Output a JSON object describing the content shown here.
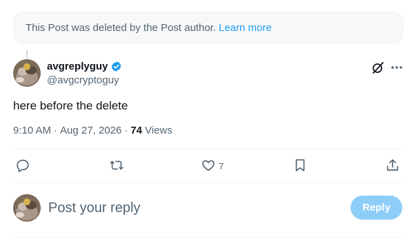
{
  "notice": {
    "text": "This Post was deleted by the Post author.",
    "link": "Learn more"
  },
  "post": {
    "author_name": "avgreplyguy",
    "handle": "@avgcryptoguy",
    "verified": true,
    "text": "here before the delete",
    "time": "9:10 AM",
    "date": "Aug 27, 2026",
    "separator": "·",
    "views_count": "74",
    "views_label": "Views"
  },
  "actions": {
    "reply_count": "",
    "repost_count": "",
    "like_count": "7",
    "bookmark_count": ""
  },
  "icons": {
    "reply": "reply-icon",
    "repost": "repost-icon",
    "like": "heart-icon",
    "bookmark": "bookmark-icon",
    "share": "share-icon",
    "grok": "grok-icon",
    "more": "more-icon",
    "verified": "verified-badge-icon"
  },
  "composer": {
    "placeholder": "Post your reply",
    "button_label": "Reply"
  },
  "colors": {
    "accent": "#1d9bf0",
    "muted_text": "#536471",
    "reply_button_disabled": "#8ecdf8"
  }
}
